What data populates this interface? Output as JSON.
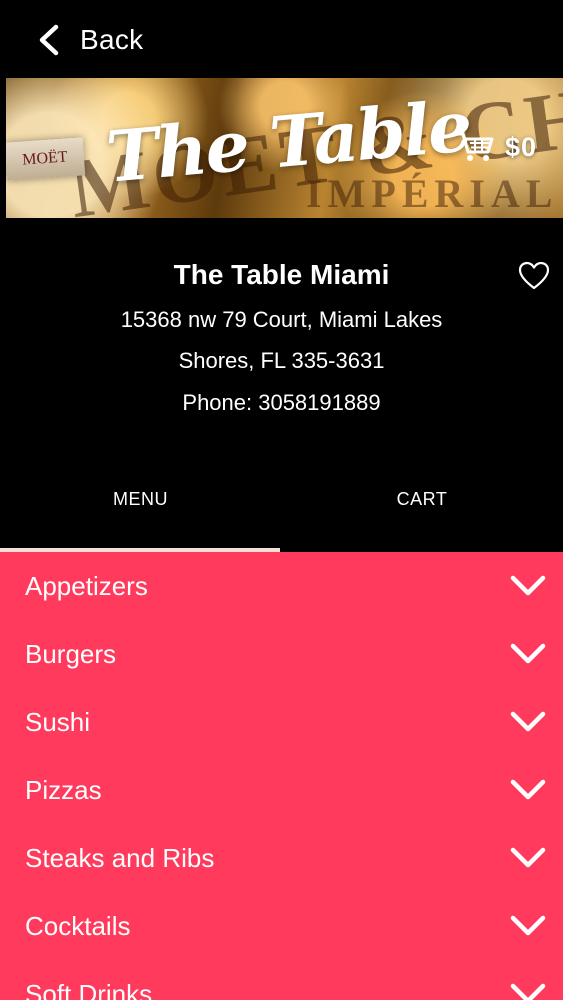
{
  "topbar": {
    "back_label": "Back"
  },
  "banner": {
    "logo_text": "The Table",
    "bg_text": "MOET & CHANDON",
    "bg_text_small": "IMPÉRIAL",
    "bottle_label": "MOËT",
    "cart_total": "$0",
    "cart_icon": "shopping-cart-icon"
  },
  "restaurant": {
    "name": "The Table Miami",
    "address_line1": "15368 nw 79 Court, Miami Lakes",
    "address_line2": "Shores, FL 335-3631",
    "phone": "Phone: 3058191889",
    "favorite_icon": "heart-outline-icon"
  },
  "tabs": [
    {
      "label": "MENU",
      "active": true
    },
    {
      "label": "CART",
      "active": false
    }
  ],
  "categories": [
    {
      "label": "Appetizers"
    },
    {
      "label": "Burgers"
    },
    {
      "label": "Sushi"
    },
    {
      "label": "Pizzas"
    },
    {
      "label": "Steaks and Ribs"
    },
    {
      "label": "Cocktails"
    },
    {
      "label": "Soft Drinks"
    }
  ],
  "colors": {
    "background": "#000000",
    "category_background": "#ff3a5c",
    "tab_indicator": "#f5dfd6",
    "text": "#ffffff"
  }
}
